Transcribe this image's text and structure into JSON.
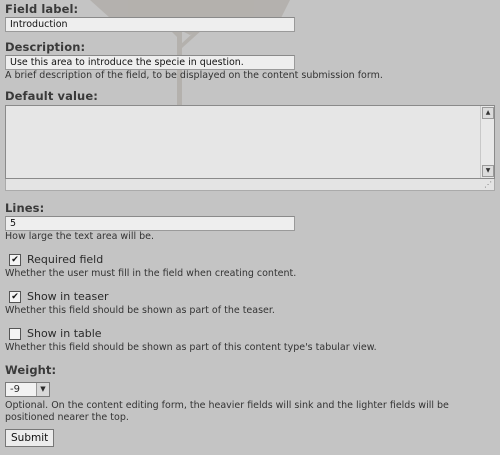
{
  "field_label": {
    "label": "Field label:",
    "value": "Introduction"
  },
  "description": {
    "label": "Description:",
    "value": "Use this area to introduce the specie in question.",
    "help": "A brief description of the field, to be displayed on the content submission form."
  },
  "default_value": {
    "label": "Default value:",
    "value": ""
  },
  "lines": {
    "label": "Lines:",
    "value": "5",
    "help": "How large the text area will be."
  },
  "required": {
    "label": "Required field",
    "checked": "✔",
    "help": "Whether the user must fill in the field when creating content."
  },
  "teaser": {
    "label": "Show in teaser",
    "checked": "✔",
    "help": "Whether this field should be shown as part of the teaser."
  },
  "table": {
    "label": "Show in table",
    "checked": "",
    "help": "Whether this field should be shown as part of this content type's tabular view."
  },
  "weight": {
    "label": "Weight:",
    "value": "-9",
    "help_line1": "Optional. On the content editing form, the heavier fields will sink and the lighter fields will be",
    "help_line2": "positioned nearer the top."
  },
  "submit": {
    "label": "Submit"
  }
}
